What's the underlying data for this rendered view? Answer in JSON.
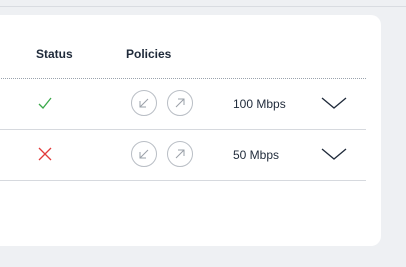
{
  "table": {
    "headers": {
      "status": "Status",
      "policies": "Policies"
    },
    "rows": [
      {
        "status": "ok",
        "status_icon": "check-icon",
        "status_color": "#3aa84a",
        "speed": "100 Mbps"
      },
      {
        "status": "error",
        "status_icon": "cross-icon",
        "status_color": "#e23b3b",
        "speed": "50 Mbps"
      }
    ]
  }
}
